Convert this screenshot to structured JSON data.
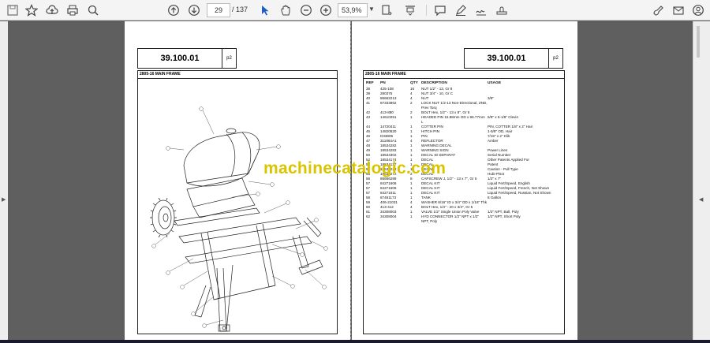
{
  "toolbar": {
    "page_current": "29",
    "page_sep_total": "/ 137",
    "zoom": "53,9%"
  },
  "icons": [
    "save-icon",
    "bookmark-star-icon",
    "upload-cloud-icon",
    "print-icon",
    "zoom-search-icon",
    "page-up-icon",
    "page-down-icon",
    "select-cursor-icon",
    "hand-pan-icon",
    "zoom-out-icon",
    "zoom-in-icon",
    "fit-page-icon",
    "scroll-mode-icon",
    "comment-icon",
    "highlight-pen-icon",
    "sign-icon",
    "edit-pdf-icon",
    "email-icon",
    "account-icon"
  ],
  "left_page": {
    "part_number": "39.100.01",
    "page_tag": "p2",
    "section": "2805-16 MAIN FRAME"
  },
  "right_page": {
    "part_number": "39.100.01",
    "page_tag": "p2",
    "section": "2805-16 MAIN FRAME",
    "headers": {
      "ref": "REF",
      "pn": "PN",
      "qty": "QTY",
      "desc": "DESCRIPTION",
      "usage": "USAGE"
    },
    "rows": [
      {
        "ref": "38",
        "pn": "425-108",
        "qty": "16",
        "desc": "NUT 1/2\" - 13, Gr 8",
        "usage": ""
      },
      {
        "ref": "39",
        "pn": "280375",
        "qty": "4",
        "desc": "NUT 3/4\" - 10, Gr C",
        "usage": ""
      },
      {
        "ref": "40",
        "pn": "86662213",
        "qty": "4",
        "desc": "NUT",
        "usage": "3/8\""
      },
      {
        "ref": "41",
        "pn": "87333862",
        "qty": "2",
        "desc": "LOCK NUT 1/2-13 Non-Directional, ZND, Prev Torq",
        "usage": ""
      },
      {
        "ref": "42",
        "pn": "413-880",
        "qty": "2",
        "desc": "BOLT Hex, 1/2\" - 13 x 8\", Gr 5",
        "usage": ""
      },
      {
        "ref": "43",
        "pn": "14610251",
        "qty": "1",
        "desc": "HEADED PIN 15.88mm OD x 96.77mm L",
        "usage": "5/8\" x 5-1/8\" Clevis"
      },
      {
        "ref": "44",
        "pn": "14720411",
        "qty": "1",
        "desc": "COTTER PIN",
        "usage": "PIN, COTTER 1/8\" x 2\" Hair"
      },
      {
        "ref": "45",
        "pn": "14820520",
        "qty": "1",
        "desc": "HITCH PIN",
        "usage": "1-5/8\" OD, Hair"
      },
      {
        "ref": "46",
        "pn": "D33805",
        "qty": "1",
        "desc": "PIN",
        "usage": "7/16\" x 2\" Klik"
      },
      {
        "ref": "47",
        "pn": "311864A1",
        "qty": "4",
        "desc": "REFLECTOR",
        "usage": "Amber"
      },
      {
        "ref": "48",
        "pn": "18534282",
        "qty": "1",
        "desc": "WARNING DECAL",
        "usage": ""
      },
      {
        "ref": "49",
        "pn": "18534283",
        "qty": "1",
        "desc": "WARNING SIGN",
        "usage": "Power Lines"
      },
      {
        "ref": "50",
        "pn": "18534302",
        "qty": "1",
        "desc": "DECAL ID SEPARAT",
        "usage": "Serial Number"
      },
      {
        "ref": "52",
        "pn": "18534174",
        "qty": "1",
        "desc": "DECAL",
        "usage": "Other Patents Applied For"
      },
      {
        "ref": "53",
        "pn": "18534137",
        "qty": "1",
        "desc": "DECAL",
        "usage": "Patent"
      },
      {
        "ref": "54",
        "pn": "18534228",
        "qty": "1",
        "desc": "DECAL",
        "usage": "Caution - Pull Type"
      },
      {
        "ref": "55",
        "pn": "18634272",
        "qty": "2",
        "desc": "DECAL",
        "usage": "Hubi-Pisot"
      },
      {
        "ref": "56",
        "pn": "86666289",
        "qty": "8",
        "desc": "CAPSCREW J, 1/2\" - 13 x 7\", Gr 5",
        "usage": "1/2\" x 7\""
      },
      {
        "ref": "57",
        "pn": "84271606",
        "qty": "1",
        "desc": "DECAL KIT",
        "usage": "Liquid Fert/Speed, English"
      },
      {
        "ref": "57",
        "pn": "84271609",
        "qty": "1",
        "desc": "DECAL KIT",
        "usage": "Liquid Fert/Speed, French, Not Shown"
      },
      {
        "ref": "57",
        "pn": "84271611",
        "qty": "1",
        "desc": "DECAL KIT",
        "usage": "Liquid Fert/Speed, Russian, Not Shown"
      },
      {
        "ref": "58",
        "pn": "87461173",
        "qty": "1",
        "desc": "TANK",
        "usage": "8 Gallon"
      },
      {
        "ref": "59",
        "pn": "406-21031",
        "qty": "4",
        "desc": "WASHER 8/16\" ID x 3/4\" OD x 1/16\" Thk",
        "usage": ""
      },
      {
        "ref": "60",
        "pn": "413-412",
        "qty": "4",
        "desc": "BOLT Hex, 1/4\" - 20 x 3/4\", Gr 5",
        "usage": ""
      },
      {
        "ref": "61",
        "pn": "34308003",
        "qty": "1",
        "desc": "VALVE 1/2\" Single Union Poly Valve",
        "usage": "1/2\" NPT, Ball, Poly"
      },
      {
        "ref": "62",
        "pn": "34308004",
        "qty": "1",
        "desc": "HYD CONNECTOR 1/2\" NPT x 1/2\" NPT, Poly",
        "usage": "1/2\" NPT, Short Poly"
      }
    ]
  },
  "watermark": "machinecatalogic.com"
}
